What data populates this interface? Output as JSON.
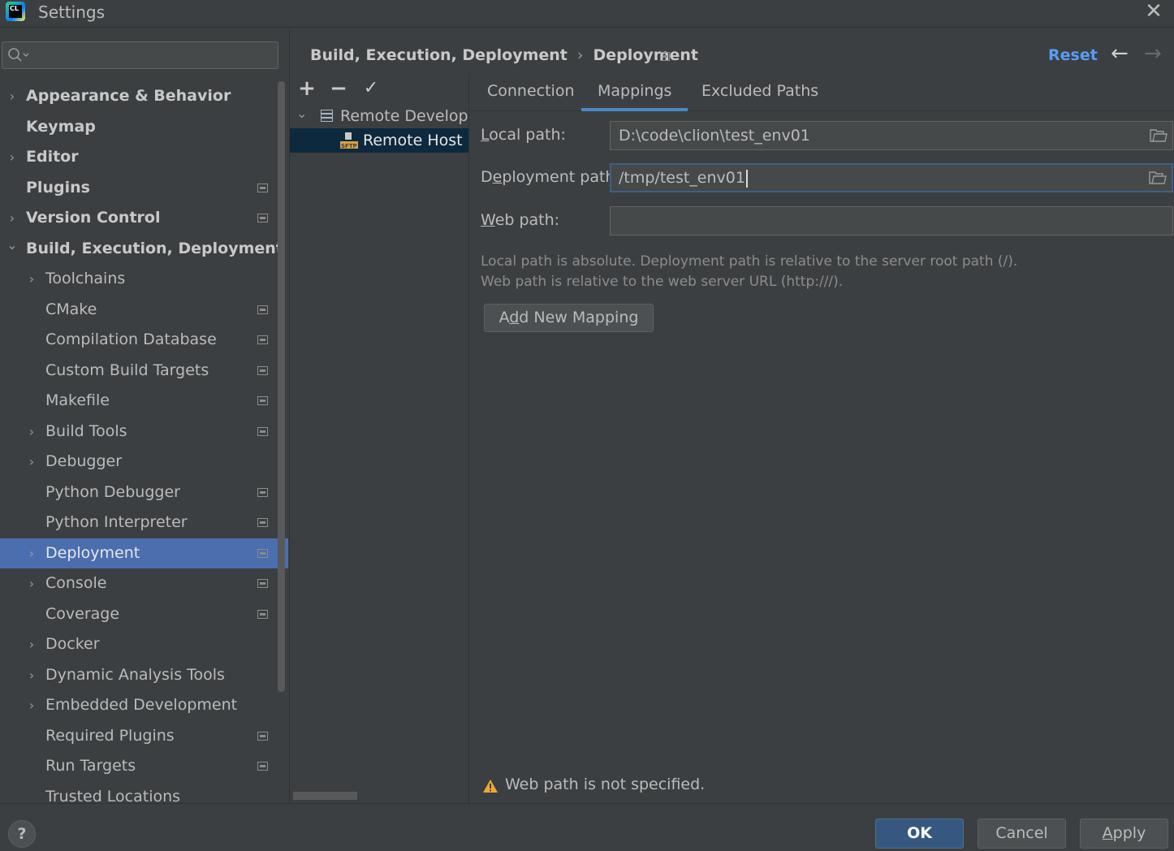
{
  "window": {
    "title": "Settings",
    "app_icon_text": "CL"
  },
  "nav": {
    "items": [
      {
        "label": "Appearance & Behavior",
        "bold": true,
        "arrow": "›",
        "indent": 0,
        "project": false
      },
      {
        "label": "Keymap",
        "bold": true,
        "arrow": "",
        "indent": 0,
        "project": false
      },
      {
        "label": "Editor",
        "bold": true,
        "arrow": "›",
        "indent": 0,
        "project": false
      },
      {
        "label": "Plugins",
        "bold": true,
        "arrow": "",
        "indent": 0,
        "project": true
      },
      {
        "label": "Version Control",
        "bold": true,
        "arrow": "›",
        "indent": 0,
        "project": true
      },
      {
        "label": "Build, Execution, Deployment",
        "bold": true,
        "arrow": "⌄",
        "indent": 0,
        "project": false
      },
      {
        "label": "Toolchains",
        "bold": false,
        "arrow": "›",
        "indent": 1,
        "project": false
      },
      {
        "label": "CMake",
        "bold": false,
        "arrow": "",
        "indent": 1,
        "project": true
      },
      {
        "label": "Compilation Database",
        "bold": false,
        "arrow": "",
        "indent": 1,
        "project": true
      },
      {
        "label": "Custom Build Targets",
        "bold": false,
        "arrow": "",
        "indent": 1,
        "project": true
      },
      {
        "label": "Makefile",
        "bold": false,
        "arrow": "",
        "indent": 1,
        "project": true
      },
      {
        "label": "Build Tools",
        "bold": false,
        "arrow": "›",
        "indent": 1,
        "project": true
      },
      {
        "label": "Debugger",
        "bold": false,
        "arrow": "›",
        "indent": 1,
        "project": false
      },
      {
        "label": "Python Debugger",
        "bold": false,
        "arrow": "",
        "indent": 1,
        "project": true
      },
      {
        "label": "Python Interpreter",
        "bold": false,
        "arrow": "",
        "indent": 1,
        "project": true
      },
      {
        "label": "Deployment",
        "bold": false,
        "arrow": "›",
        "indent": 1,
        "project": true,
        "selected": true
      },
      {
        "label": "Console",
        "bold": false,
        "arrow": "›",
        "indent": 1,
        "project": true
      },
      {
        "label": "Coverage",
        "bold": false,
        "arrow": "",
        "indent": 1,
        "project": true
      },
      {
        "label": "Docker",
        "bold": false,
        "arrow": "›",
        "indent": 1,
        "project": false
      },
      {
        "label": "Dynamic Analysis Tools",
        "bold": false,
        "arrow": "›",
        "indent": 1,
        "project": false
      },
      {
        "label": "Embedded Development",
        "bold": false,
        "arrow": "›",
        "indent": 1,
        "project": false
      },
      {
        "label": "Required Plugins",
        "bold": false,
        "arrow": "",
        "indent": 1,
        "project": true
      },
      {
        "label": "Run Targets",
        "bold": false,
        "arrow": "",
        "indent": 1,
        "project": true
      },
      {
        "label": "Trusted Locations",
        "bold": false,
        "arrow": "",
        "indent": 1,
        "project": false
      }
    ]
  },
  "header": {
    "breadcrumb_parent": "Build, Execution, Deployment",
    "breadcrumb_sep": "›",
    "breadcrumb_current": "Deployment",
    "reset_label": "Reset",
    "back_arrow": "←",
    "forward_arrow": "→"
  },
  "tree": {
    "toolbar": {
      "add": "+",
      "remove": "−",
      "default": "✓"
    },
    "root_label": "Remote Developm",
    "root_arrow": "⌄",
    "child_label": "Remote Host (a"
  },
  "tabs": [
    {
      "label": "Connection"
    },
    {
      "label": "Mappings",
      "active": true
    },
    {
      "label": "Excluded Paths"
    }
  ],
  "form": {
    "local_path_label_pre": "",
    "local_path_label_u": "L",
    "local_path_label_post": "ocal path:",
    "local_path_value": "D:\\code\\clion\\test_env01",
    "deployment_path_label_pre": "D",
    "deployment_path_label_u": "e",
    "deployment_path_label_post": "ployment path:",
    "deployment_path_value": "/tmp/test_env01",
    "web_path_label_pre": "",
    "web_path_label_u": "W",
    "web_path_label_post": "eb path:",
    "web_path_value": ""
  },
  "hints": {
    "line1": "Local path is absolute. Deployment path is relative to the server root path (/).",
    "line2": "Web path is relative to the web server URL (http:///)."
  },
  "add_mapping": {
    "pre": "A",
    "u": "d",
    "post": "d New Mapping"
  },
  "warning": {
    "text": "Web path is not specified."
  },
  "buttons": {
    "help": "?",
    "ok": "OK",
    "cancel": "Cancel",
    "apply_u": "A",
    "apply_post": "pply"
  },
  "colors": {
    "background": "#3c3f41",
    "selection": "#4b6eaf",
    "link": "#589df6",
    "ok_button": "#365880",
    "warning": "#f0a732"
  }
}
